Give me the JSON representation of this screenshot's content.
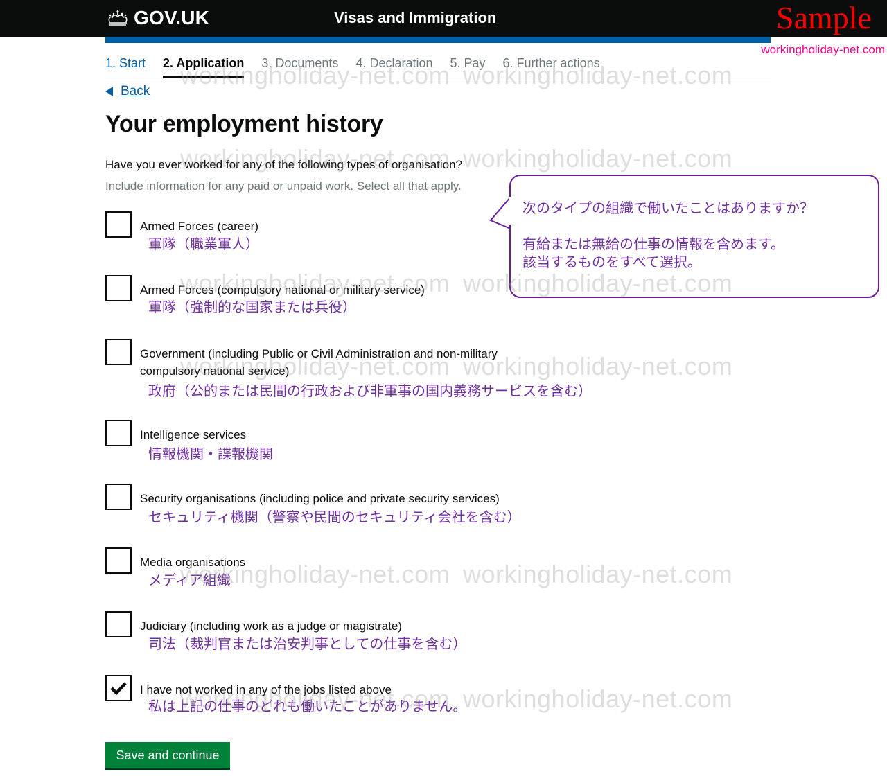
{
  "header": {
    "logo_text": "GOV.UK",
    "service_name": "Visas and Immigration",
    "sample_label": "Sample",
    "site_link": "workingholiday-net.com",
    "colors": {
      "header_bg": "#0b0c0c",
      "blue_bar": "#005ea5",
      "sample": "#ff0000",
      "site_link": "#ec008c"
    }
  },
  "steps": [
    {
      "label": "1. Start",
      "state": "done"
    },
    {
      "label": "2. Application",
      "state": "active"
    },
    {
      "label": "3. Documents",
      "state": "pending"
    },
    {
      "label": "4. Declaration",
      "state": "pending"
    },
    {
      "label": "5. Pay",
      "state": "pending"
    },
    {
      "label": "6. Further actions",
      "state": "pending"
    }
  ],
  "back_link": "Back",
  "page_title": "Your employment history",
  "question": "Have you ever worked for any of the following types of organisation?",
  "hint": "Include information for any paid or unpaid work. Select all that apply.",
  "callout": {
    "line1": "次のタイプの組織で働いたことはありますか？",
    "line2": "有給または無給の仕事の情報を含めます。",
    "line3": "該当するものをすべて選択。"
  },
  "options": [
    {
      "label": "Armed Forces (career)",
      "jp": "軍隊（職業軍人）",
      "checked": false
    },
    {
      "label": "Armed Forces (compulsory national or military service)",
      "jp": "軍隊（強制的な国家または兵役）",
      "checked": false
    },
    {
      "label": "Government (including Public or Civil Administration and non-military compulsory national service)",
      "jp": "政府（公的または民間の行政および非軍事の国内義務サービスを含む）",
      "checked": false
    },
    {
      "label": "Intelligence services",
      "jp": "情報機関・諜報機関",
      "checked": false
    },
    {
      "label": "Security organisations (including police and private security services)",
      "jp": "セキュリティ機関（警察や民間のセキュリティ会社を含む）",
      "checked": false
    },
    {
      "label": "Media organisations",
      "jp": "メディア組織",
      "checked": false
    },
    {
      "label": "Judiciary (including work as a judge or magistrate)",
      "jp": "司法（裁判官または治安判事としての仕事を含む）",
      "checked": false
    },
    {
      "label": "I have not worked in any of the jobs listed above",
      "jp": "私は上記の仕事のどれも働いたことがありません。",
      "checked": true
    }
  ],
  "submit_label": "Save and continue",
  "watermark": "workingholiday-net.com"
}
